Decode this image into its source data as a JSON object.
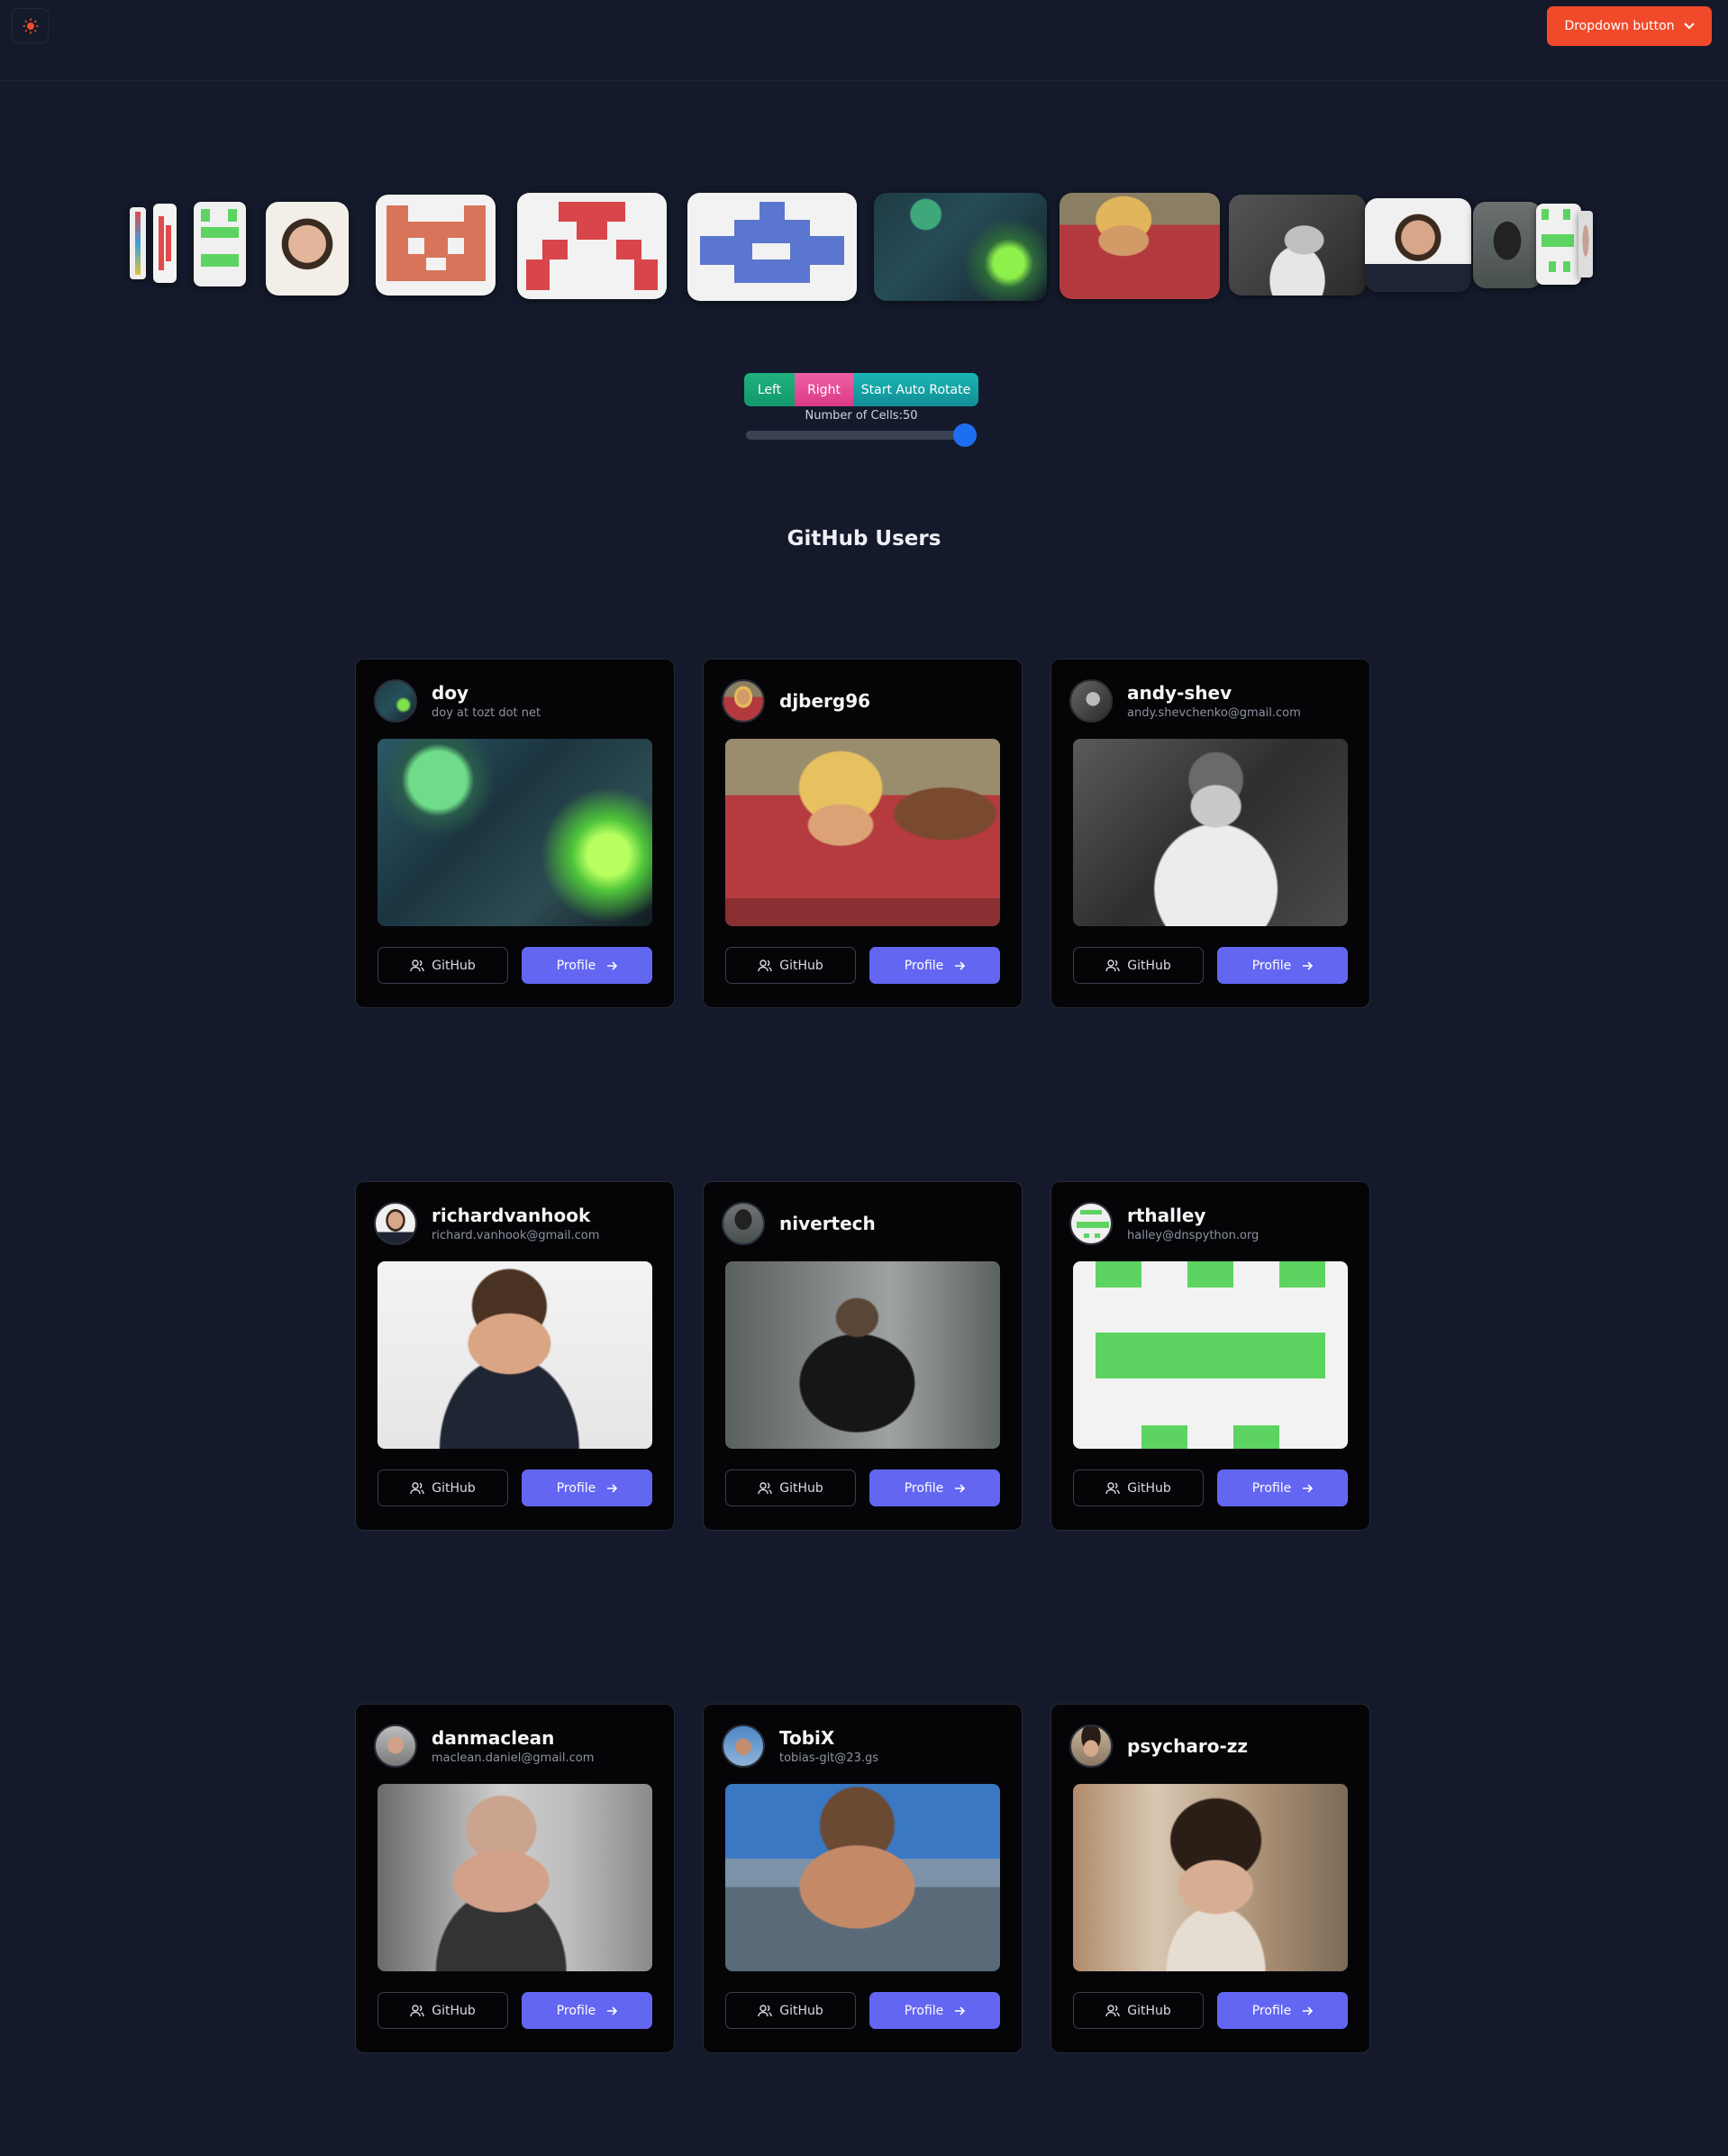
{
  "header": {
    "theme_icon": "sun-icon",
    "dropdown_label": "Dropdown button",
    "dropdown_icon": "chevron-down-icon",
    "accent_color": "#f04a2b"
  },
  "carousel": {
    "controls": {
      "left_label": "Left",
      "right_label": "Right",
      "auto_label": "Start Auto Rotate",
      "cells_label": "Number of Cells:50",
      "cells_value": 50
    }
  },
  "section": {
    "title": "GitHub Users"
  },
  "users": [
    {
      "username": "doy",
      "email": "doy at tozt dot net",
      "github_label": "GitHub",
      "profile_label": "Profile"
    },
    {
      "username": "djberg96",
      "email": "",
      "github_label": "GitHub",
      "profile_label": "Profile"
    },
    {
      "username": "andy-shev",
      "email": "andy.shevchenko@gmail.com",
      "github_label": "GitHub",
      "profile_label": "Profile"
    },
    {
      "username": "richardvanhook",
      "email": "richard.vanhook@gmail.com",
      "github_label": "GitHub",
      "profile_label": "Profile"
    },
    {
      "username": "nivertech",
      "email": "",
      "github_label": "GitHub",
      "profile_label": "Profile"
    },
    {
      "username": "rthalley",
      "email": "halley@dnspython.org",
      "github_label": "GitHub",
      "profile_label": "Profile"
    },
    {
      "username": "danmaclean",
      "email": "maclean.daniel@gmail.com",
      "github_label": "GitHub",
      "profile_label": "Profile"
    },
    {
      "username": "TobiX",
      "email": "tobias-git@23.gs",
      "github_label": "GitHub",
      "profile_label": "Profile"
    },
    {
      "username": "psycharo-zz",
      "email": "",
      "github_label": "GitHub",
      "profile_label": "Profile"
    }
  ]
}
